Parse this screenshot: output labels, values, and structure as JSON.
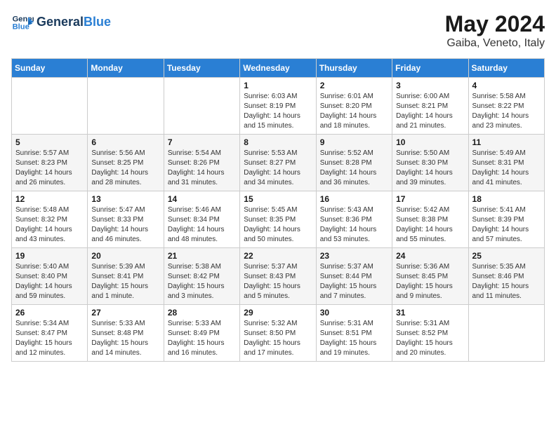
{
  "header": {
    "logo_line1": "General",
    "logo_line2": "Blue",
    "title": "May 2024",
    "subtitle": "Gaiba, Veneto, Italy"
  },
  "calendar": {
    "days_of_week": [
      "Sunday",
      "Monday",
      "Tuesday",
      "Wednesday",
      "Thursday",
      "Friday",
      "Saturday"
    ],
    "weeks": [
      [
        {
          "day": "",
          "info": ""
        },
        {
          "day": "",
          "info": ""
        },
        {
          "day": "",
          "info": ""
        },
        {
          "day": "1",
          "info": "Sunrise: 6:03 AM\nSunset: 8:19 PM\nDaylight: 14 hours\nand 15 minutes."
        },
        {
          "day": "2",
          "info": "Sunrise: 6:01 AM\nSunset: 8:20 PM\nDaylight: 14 hours\nand 18 minutes."
        },
        {
          "day": "3",
          "info": "Sunrise: 6:00 AM\nSunset: 8:21 PM\nDaylight: 14 hours\nand 21 minutes."
        },
        {
          "day": "4",
          "info": "Sunrise: 5:58 AM\nSunset: 8:22 PM\nDaylight: 14 hours\nand 23 minutes."
        }
      ],
      [
        {
          "day": "5",
          "info": "Sunrise: 5:57 AM\nSunset: 8:23 PM\nDaylight: 14 hours\nand 26 minutes."
        },
        {
          "day": "6",
          "info": "Sunrise: 5:56 AM\nSunset: 8:25 PM\nDaylight: 14 hours\nand 28 minutes."
        },
        {
          "day": "7",
          "info": "Sunrise: 5:54 AM\nSunset: 8:26 PM\nDaylight: 14 hours\nand 31 minutes."
        },
        {
          "day": "8",
          "info": "Sunrise: 5:53 AM\nSunset: 8:27 PM\nDaylight: 14 hours\nand 34 minutes."
        },
        {
          "day": "9",
          "info": "Sunrise: 5:52 AM\nSunset: 8:28 PM\nDaylight: 14 hours\nand 36 minutes."
        },
        {
          "day": "10",
          "info": "Sunrise: 5:50 AM\nSunset: 8:30 PM\nDaylight: 14 hours\nand 39 minutes."
        },
        {
          "day": "11",
          "info": "Sunrise: 5:49 AM\nSunset: 8:31 PM\nDaylight: 14 hours\nand 41 minutes."
        }
      ],
      [
        {
          "day": "12",
          "info": "Sunrise: 5:48 AM\nSunset: 8:32 PM\nDaylight: 14 hours\nand 43 minutes."
        },
        {
          "day": "13",
          "info": "Sunrise: 5:47 AM\nSunset: 8:33 PM\nDaylight: 14 hours\nand 46 minutes."
        },
        {
          "day": "14",
          "info": "Sunrise: 5:46 AM\nSunset: 8:34 PM\nDaylight: 14 hours\nand 48 minutes."
        },
        {
          "day": "15",
          "info": "Sunrise: 5:45 AM\nSunset: 8:35 PM\nDaylight: 14 hours\nand 50 minutes."
        },
        {
          "day": "16",
          "info": "Sunrise: 5:43 AM\nSunset: 8:36 PM\nDaylight: 14 hours\nand 53 minutes."
        },
        {
          "day": "17",
          "info": "Sunrise: 5:42 AM\nSunset: 8:38 PM\nDaylight: 14 hours\nand 55 minutes."
        },
        {
          "day": "18",
          "info": "Sunrise: 5:41 AM\nSunset: 8:39 PM\nDaylight: 14 hours\nand 57 minutes."
        }
      ],
      [
        {
          "day": "19",
          "info": "Sunrise: 5:40 AM\nSunset: 8:40 PM\nDaylight: 14 hours\nand 59 minutes."
        },
        {
          "day": "20",
          "info": "Sunrise: 5:39 AM\nSunset: 8:41 PM\nDaylight: 15 hours\nand 1 minute."
        },
        {
          "day": "21",
          "info": "Sunrise: 5:38 AM\nSunset: 8:42 PM\nDaylight: 15 hours\nand 3 minutes."
        },
        {
          "day": "22",
          "info": "Sunrise: 5:37 AM\nSunset: 8:43 PM\nDaylight: 15 hours\nand 5 minutes."
        },
        {
          "day": "23",
          "info": "Sunrise: 5:37 AM\nSunset: 8:44 PM\nDaylight: 15 hours\nand 7 minutes."
        },
        {
          "day": "24",
          "info": "Sunrise: 5:36 AM\nSunset: 8:45 PM\nDaylight: 15 hours\nand 9 minutes."
        },
        {
          "day": "25",
          "info": "Sunrise: 5:35 AM\nSunset: 8:46 PM\nDaylight: 15 hours\nand 11 minutes."
        }
      ],
      [
        {
          "day": "26",
          "info": "Sunrise: 5:34 AM\nSunset: 8:47 PM\nDaylight: 15 hours\nand 12 minutes."
        },
        {
          "day": "27",
          "info": "Sunrise: 5:33 AM\nSunset: 8:48 PM\nDaylight: 15 hours\nand 14 minutes."
        },
        {
          "day": "28",
          "info": "Sunrise: 5:33 AM\nSunset: 8:49 PM\nDaylight: 15 hours\nand 16 minutes."
        },
        {
          "day": "29",
          "info": "Sunrise: 5:32 AM\nSunset: 8:50 PM\nDaylight: 15 hours\nand 17 minutes."
        },
        {
          "day": "30",
          "info": "Sunrise: 5:31 AM\nSunset: 8:51 PM\nDaylight: 15 hours\nand 19 minutes."
        },
        {
          "day": "31",
          "info": "Sunrise: 5:31 AM\nSunset: 8:52 PM\nDaylight: 15 hours\nand 20 minutes."
        },
        {
          "day": "",
          "info": ""
        }
      ]
    ]
  }
}
